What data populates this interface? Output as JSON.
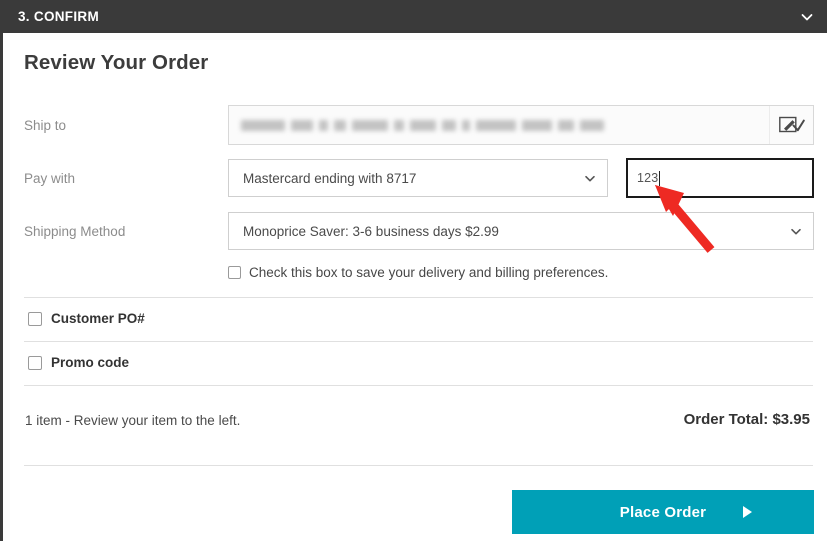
{
  "step_header": {
    "title": "3. CONFIRM",
    "collapse_icon": "chevron-down-icon"
  },
  "panel": {
    "title": "Review Your Order"
  },
  "ship_to": {
    "label": "Ship to",
    "value_redacted": true,
    "edit_icon": "edit-pencil-icon"
  },
  "pay_with": {
    "label": "Pay with",
    "selected": "Mastercard ending with 8717",
    "dropdown_icon": "chevron-down-icon",
    "cvv": {
      "value": "123",
      "focused": true
    }
  },
  "shipping_method": {
    "label": "Shipping Method",
    "selected": "Monoprice Saver: 3-6 business days $2.99",
    "dropdown_icon": "chevron-down-icon"
  },
  "save_preferences": {
    "label": "Check this box to save your delivery and billing preferences.",
    "checked": false
  },
  "customer_po": {
    "label": "Customer PO#",
    "checked": false
  },
  "promo_code": {
    "label": "Promo code",
    "checked": false
  },
  "summary": {
    "items_text": "1 item - Review your item to the left.",
    "order_total": "Order Total: $3.95"
  },
  "place_order": {
    "label": "Place Order",
    "arrow_icon": "triangle-right-icon"
  },
  "colors": {
    "header_bg": "#3a3a3a",
    "accent_teal": "#00a0b7",
    "annotation_red": "#ee2a23",
    "label_gray": "#8c8c8c",
    "border_gray": "#cfcfcf"
  },
  "annotation": {
    "type": "arrow",
    "points_to": "cvv-input",
    "color": "#ee2a23"
  }
}
